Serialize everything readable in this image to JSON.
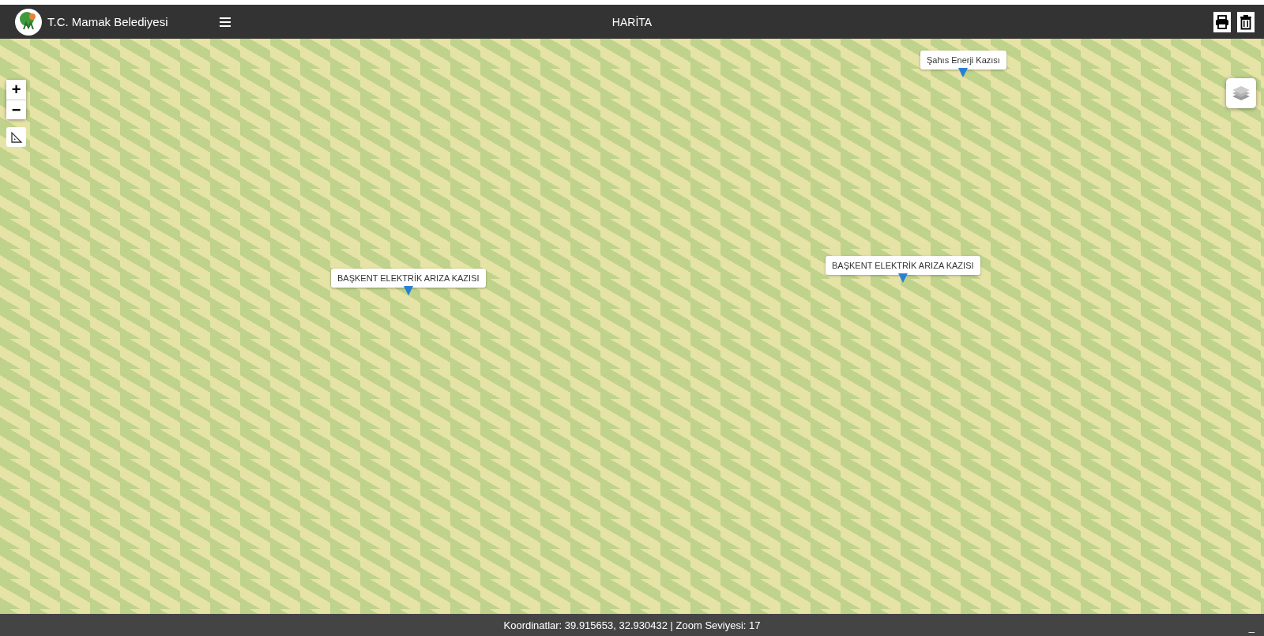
{
  "header": {
    "title": "T.C. Mamak Belediyesi",
    "page_title": "HARİTA"
  },
  "map": {
    "zoom_controls": [
      "+",
      "−"
    ],
    "markers": [
      {
        "label": "BAŞKENT ELEKTRİK ARIZA KAZISI"
      },
      {
        "label": "BAŞKENT ELEKTRİK ARIZA KAZISI"
      },
      {
        "label": "Şahıs Enerji Kazısı"
      }
    ]
  },
  "status_bar": {
    "text": "Koordinatlar: 39.915653, 32.930432 | Zoom Seviyesi: 17",
    "minimize": "_"
  }
}
